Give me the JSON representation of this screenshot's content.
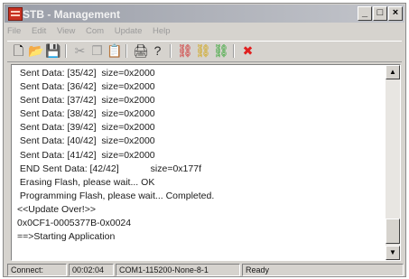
{
  "window": {
    "title": "STB - Management",
    "controls": {
      "minimize": "_",
      "maximize": "□",
      "close": "×"
    }
  },
  "menu": {
    "items": [
      "File",
      "Edit",
      "View",
      "Com",
      "Update",
      "Help"
    ]
  },
  "toolbar": {
    "buttons": [
      {
        "icon": "new-document-icon",
        "glyph": "🗋",
        "color": "#000000"
      },
      {
        "icon": "open-folder-icon",
        "glyph": "📂",
        "color": "#c09000"
      },
      {
        "icon": "save-disk-icon",
        "glyph": "💾",
        "color": "#1a2a7a"
      },
      {
        "icon": "cut-icon",
        "glyph": "✂",
        "color": "#9a9a9a"
      },
      {
        "icon": "copy-icon",
        "glyph": "❐",
        "color": "#9a9a9a"
      },
      {
        "icon": "paste-icon",
        "glyph": "📋",
        "color": "#9a9a9a"
      },
      {
        "icon": "print-icon",
        "glyph": "🖨",
        "color": "#303030"
      },
      {
        "icon": "help-icon",
        "glyph": "?",
        "color": "#2a2a2a"
      },
      {
        "icon": "connect-red-icon",
        "glyph": "⛓",
        "color": "#d02020"
      },
      {
        "icon": "connect-yellow-icon",
        "glyph": "⛓",
        "color": "#d0a000"
      },
      {
        "icon": "connect-green-icon",
        "glyph": "⛓",
        "color": "#20a020"
      },
      {
        "icon": "stop-x-icon",
        "glyph": "✖",
        "color": "#e02020"
      }
    ]
  },
  "log": {
    "lines": [
      " Sent Data: [35/42]  size=0x2000",
      " Sent Data: [36/42]  size=0x2000",
      " Sent Data: [37/42]  size=0x2000",
      " Sent Data: [38/42]  size=0x2000",
      " Sent Data: [39/42]  size=0x2000",
      " Sent Data: [40/42]  size=0x2000",
      " Sent Data: [41/42]  size=0x2000",
      " END Sent Data: [42/42]            size=0x177f",
      " Erasing Flash, please wait... OK",
      " Programming Flash, please wait... Completed.",
      "<<Update Over!>>",
      "0x0CF1-0005377B-0x0024",
      "==>Starting Application"
    ]
  },
  "statusbar": {
    "connect_label": "Connect:",
    "elapsed": "00:02:04",
    "port": "COM1-115200-None-8-1",
    "state": "Ready"
  }
}
